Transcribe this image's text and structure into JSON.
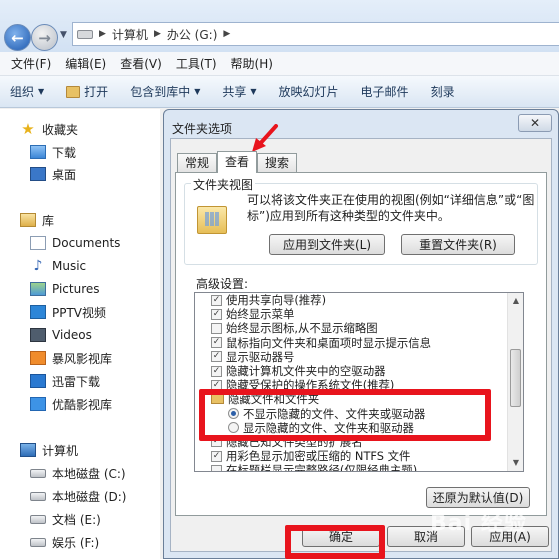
{
  "address": {
    "crumbs": [
      "计算机",
      "办公 (G:)"
    ]
  },
  "menu": [
    "文件(F)",
    "编辑(E)",
    "查看(V)",
    "工具(T)",
    "帮助(H)"
  ],
  "toolbar": {
    "organize": "组织",
    "open": "打开",
    "include": "包含到库中",
    "share": "共享",
    "slideshow": "放映幻灯片",
    "email": "电子邮件",
    "burn": "刻录"
  },
  "nav": {
    "favorites": "收藏夹",
    "downloads": "下载",
    "desktop": "桌面",
    "libraries": "库",
    "documents": "Documents",
    "music": "Music",
    "pictures": "Pictures",
    "pptv": "PPTV视频",
    "videos": "Videos",
    "baofeng": "暴风影视库",
    "xunlei": "迅雷下载",
    "youku": "优酷影视库",
    "computer": "计算机",
    "drive_c": "本地磁盘 (C:)",
    "drive_d": "本地磁盘 (D:)",
    "drive_e": "文档 (E:)",
    "drive_f": "娱乐 (F:)"
  },
  "dialog": {
    "title": "文件夹选项",
    "close": "✕",
    "tabs": [
      "常规",
      "查看",
      "搜索"
    ],
    "folder_view": {
      "label": "文件夹视图",
      "desc": "可以将该文件夹正在使用的视图(例如“详细信息”或“图标”)应用到所有这种类型的文件夹中。",
      "apply_btn": "应用到文件夹(L)",
      "reset_btn": "重置文件夹(R)"
    },
    "advanced_label": "高级设置:",
    "advanced": [
      "使用共享向导(推荐)",
      "始终显示菜单",
      "始终显示图标,从不显示缩略图",
      "鼠标指向文件夹和桌面项时显示提示信息",
      "显示驱动器号",
      "隐藏计算机文件夹中的空驱动器",
      "隐藏受保护的操作系统文件(推荐)",
      "隐藏文件和文件夹",
      "不显示隐藏的文件、文件夹或驱动器",
      "显示隐藏的文件、文件夹和驱动器",
      "隐藏已知文件类型的扩展名",
      "用彩色显示加密或压缩的 NTFS 文件",
      "在标题栏显示完整路径(仅限经典主题)"
    ],
    "restore_btn": "还原为默认值(D)",
    "ok_btn": "确定",
    "cancel_btn": "取消",
    "apply_btn": "应用(A)"
  },
  "watermark": "Bai 经验",
  "colors": {
    "annotation_red": "#e8141d",
    "accent_blue": "#2c5fa8"
  }
}
